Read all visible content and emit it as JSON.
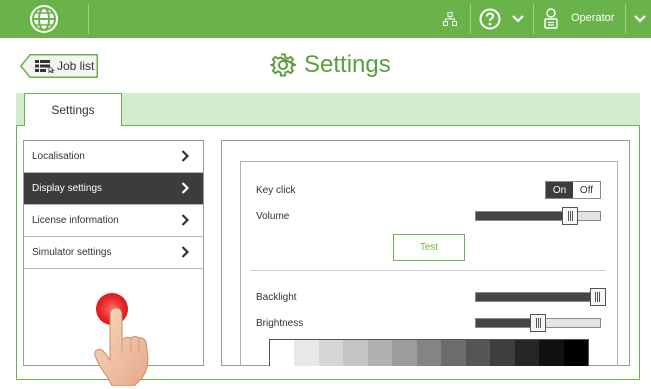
{
  "topbar": {
    "user_label": "Operator",
    "icons": [
      "globe-icon",
      "network-icon",
      "help-icon",
      "chevron-down-icon",
      "operator-icon",
      "chevron-down-icon"
    ]
  },
  "header": {
    "back_button_label": "Job list",
    "title": "Settings"
  },
  "tabs": [
    {
      "label": "Settings",
      "active": true
    }
  ],
  "menu": {
    "items": [
      {
        "label": "Localisation",
        "active": false
      },
      {
        "label": "Display settings",
        "active": true
      },
      {
        "label": "License information",
        "active": false
      },
      {
        "label": "Simulator settings",
        "active": false
      }
    ]
  },
  "display_settings": {
    "key_click": {
      "label": "Key click",
      "on_label": "On",
      "off_label": "Off",
      "value": "On"
    },
    "volume": {
      "label": "Volume",
      "level": 0.76
    },
    "test_button_label": "Test",
    "backlight": {
      "label": "Backlight",
      "level": 0.98
    },
    "brightness": {
      "label": "Brightness",
      "level": 0.5
    },
    "grayscale_swatches": [
      "#ffffff",
      "#e8e8e8",
      "#d6d6d6",
      "#c4c4c4",
      "#b0b0b0",
      "#9c9c9c",
      "#848484",
      "#6c6c6c",
      "#555555",
      "#3e3e3e",
      "#262626",
      "#111111",
      "#000000"
    ]
  },
  "colors": {
    "accent_green": "#6ab24a",
    "tab_band": "#d3eacc",
    "active_menu": "#3c3c3c",
    "touch_indicator": "#e52323"
  }
}
